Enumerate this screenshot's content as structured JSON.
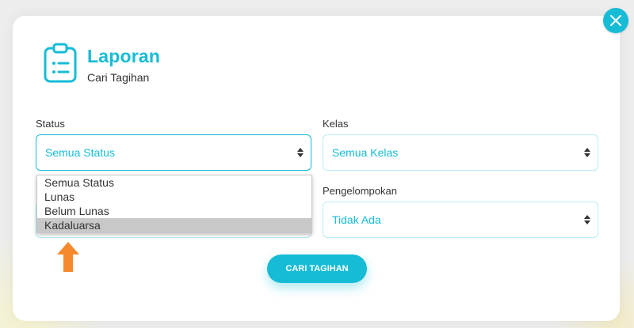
{
  "header": {
    "title": "Laporan",
    "subtitle": "Cari Tagihan",
    "icon": "clipboard-list-icon"
  },
  "filters": {
    "status": {
      "label": "Status",
      "value": "Semua Status",
      "options": [
        "Semua Status",
        "Lunas",
        "Belum Lunas",
        "Kadaluarsa"
      ],
      "highlighted": "Kadaluarsa"
    },
    "kelas": {
      "label": "Kelas",
      "value": "Semua Kelas"
    },
    "pengelompokan": {
      "label": "Pengelompokan",
      "value": "Tidak Ada"
    }
  },
  "actions": {
    "search_label": "CARI TAGIHAN"
  },
  "colors": {
    "accent": "#16bcd6",
    "arrow": "#f5892c",
    "hover": "#c8c8c8"
  }
}
